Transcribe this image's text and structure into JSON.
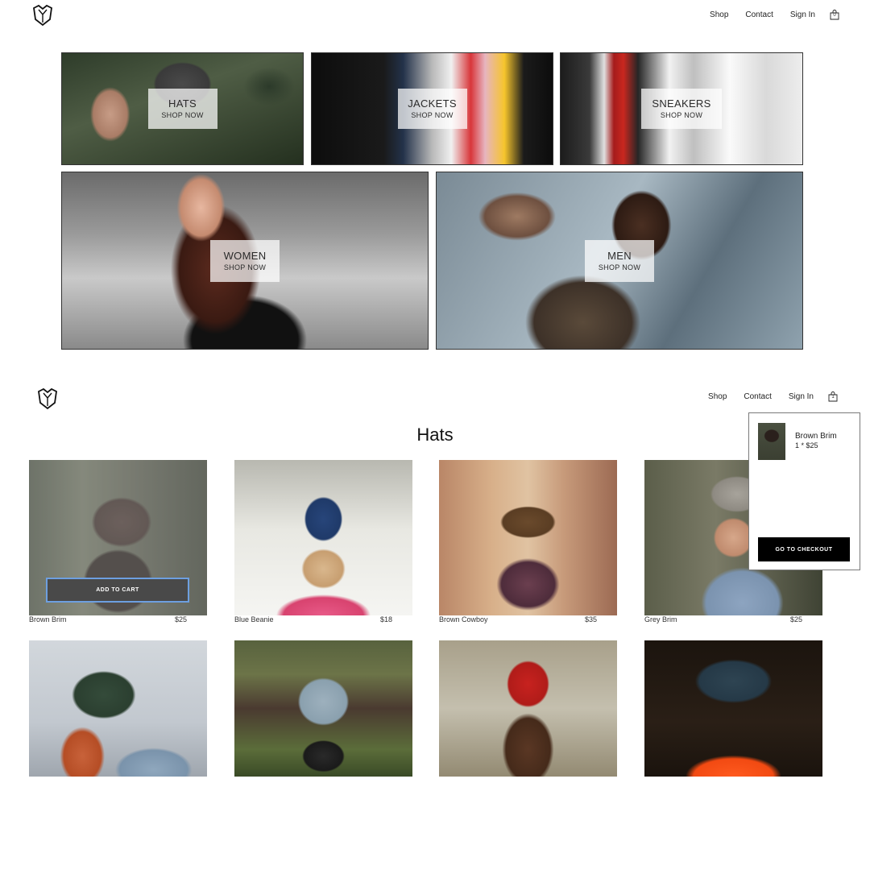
{
  "homepage": {
    "nav": {
      "shop": "Shop",
      "contact": "Contact",
      "sign_in": "Sign In",
      "cart_count": "0"
    },
    "categories": [
      {
        "title": "HATS",
        "cta": "SHOP NOW"
      },
      {
        "title": "JACKETS",
        "cta": "SHOP NOW"
      },
      {
        "title": "SNEAKERS",
        "cta": "SHOP NOW"
      },
      {
        "title": "WOMEN",
        "cta": "SHOP NOW"
      },
      {
        "title": "MEN",
        "cta": "SHOP NOW"
      }
    ]
  },
  "hats_page": {
    "nav": {
      "shop": "Shop",
      "contact": "Contact",
      "sign_in": "Sign In",
      "cart_count": "1"
    },
    "title": "Hats",
    "add_to_cart_label": "ADD TO CART",
    "products": [
      {
        "name": "Brown Brim",
        "price": "$25"
      },
      {
        "name": "Blue Beanie",
        "price": "$18"
      },
      {
        "name": "Brown Cowboy",
        "price": "$35"
      },
      {
        "name": "Grey Brim",
        "price": "$25"
      }
    ],
    "cart_dropdown": {
      "item_name": "Brown Brim",
      "item_qty": "1 * $25",
      "checkout_label": "GO TO CHECKOUT"
    }
  },
  "icons": {
    "logo": "crown-logo-icon",
    "cart": "shopping-bag-icon"
  },
  "colors": {
    "button_bg": "#0d0d0d",
    "button_focus_border": "#3d7fd6",
    "label_overlay": "rgba(255,255,255,0.72)"
  }
}
